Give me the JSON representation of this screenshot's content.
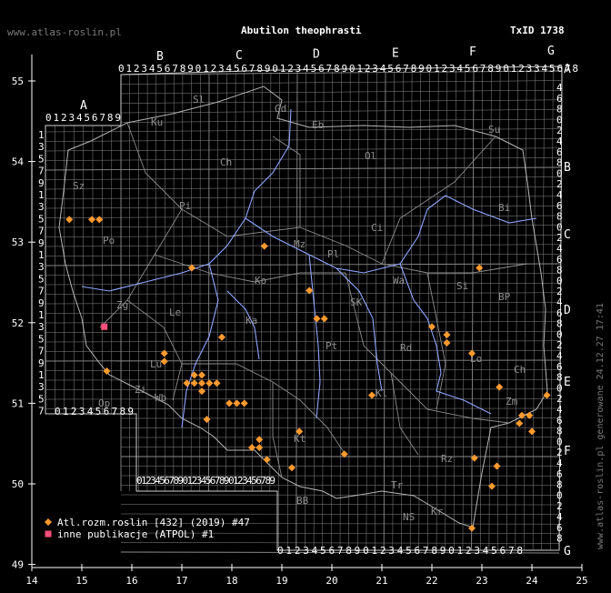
{
  "header": {
    "site": "www.atlas-roslin.pl",
    "title": "Abutilon theophrasti",
    "txid": "TxID 1738",
    "generated": "www.atlas-roslin.pl generowane 24.12.27 17:41"
  },
  "colors": {
    "background": "#000000",
    "grid": "#8a8a8a",
    "region_label": "#8f8f8f",
    "river": "#8fa6ff",
    "point_orange": "#ff9a2e",
    "point_pink": "#ff4f7b"
  },
  "axes": {
    "x_ticks": [
      "14",
      "15",
      "16",
      "17",
      "18",
      "19",
      "20",
      "21",
      "22",
      "23",
      "24",
      "25"
    ],
    "y_ticks": [
      "55",
      "54",
      "53",
      "52",
      "51",
      "50",
      "49"
    ]
  },
  "atpol": {
    "top_letters": [
      "B",
      "C",
      "D",
      "E",
      "F",
      "G"
    ],
    "left_letter": "A",
    "right_letters": [
      "A",
      "B",
      "C",
      "D",
      "E",
      "F",
      "G"
    ],
    "digits": "0123456789",
    "top_row": "012345678901234567890123456789012345678901234567890123345678",
    "left_top_row": "0123456789",
    "left_bottom_row": "0123456789",
    "bottom_row_left": "012345678901234567890123456789",
    "bottom_row_right": "01234567890123456789012345678",
    "right_col_labels": [
      "4",
      "6",
      "8",
      "0",
      "2",
      "4",
      "6",
      "8"
    ]
  },
  "region_labels": [
    "Sl",
    "Gd",
    "Eb",
    "Ku",
    "Ol",
    "Su",
    "Ch",
    "Sz",
    "Pi",
    "Bi",
    "Ci",
    "Pl",
    "Mz",
    "Po",
    "Ko",
    "Wa",
    "Si",
    "BP",
    "Zg",
    "Le",
    "Ka",
    "SK",
    "Lu",
    "Pt",
    "Rd",
    "Lo",
    "Zi",
    "Wb",
    "Ch",
    "Kl",
    "Op",
    "Zm",
    "Kt",
    "Tr",
    "Rz",
    "BB",
    "NS",
    "Kr"
  ],
  "legend": {
    "items": [
      {
        "label": "Atl.rozm.roslin [432] (2019) #47",
        "symbol": "diamond",
        "color": "#ff9a2e"
      },
      {
        "label": "inne publikacje (ATPOL) #1",
        "symbol": "square",
        "color": "#ff4f7b"
      }
    ]
  },
  "points_orange": [
    {
      "lon": 14.75,
      "lat": 53.28
    },
    {
      "lon": 15.2,
      "lat": 53.28
    },
    {
      "lon": 15.35,
      "lat": 53.28
    },
    {
      "lon": 18.65,
      "lat": 52.95
    },
    {
      "lon": 17.2,
      "lat": 52.68
    },
    {
      "lon": 22.95,
      "lat": 52.68
    },
    {
      "lon": 19.55,
      "lat": 52.4
    },
    {
      "lon": 19.7,
      "lat": 52.05
    },
    {
      "lon": 19.85,
      "lat": 52.05
    },
    {
      "lon": 22.0,
      "lat": 51.95
    },
    {
      "lon": 22.3,
      "lat": 51.85
    },
    {
      "lon": 22.3,
      "lat": 51.75
    },
    {
      "lon": 17.8,
      "lat": 51.82
    },
    {
      "lon": 22.8,
      "lat": 51.62
    },
    {
      "lon": 16.65,
      "lat": 51.62
    },
    {
      "lon": 16.65,
      "lat": 51.52
    },
    {
      "lon": 15.5,
      "lat": 51.4
    },
    {
      "lon": 17.25,
      "lat": 51.35
    },
    {
      "lon": 17.4,
      "lat": 51.35
    },
    {
      "lon": 17.1,
      "lat": 51.25
    },
    {
      "lon": 17.25,
      "lat": 51.25
    },
    {
      "lon": 17.4,
      "lat": 51.25
    },
    {
      "lon": 17.55,
      "lat": 51.25
    },
    {
      "lon": 17.7,
      "lat": 51.25
    },
    {
      "lon": 17.4,
      "lat": 51.15
    },
    {
      "lon": 23.35,
      "lat": 51.2
    },
    {
      "lon": 20.8,
      "lat": 51.1
    },
    {
      "lon": 24.3,
      "lat": 51.1
    },
    {
      "lon": 17.95,
      "lat": 51.0
    },
    {
      "lon": 18.1,
      "lat": 51.0
    },
    {
      "lon": 18.25,
      "lat": 51.0
    },
    {
      "lon": 23.8,
      "lat": 50.85
    },
    {
      "lon": 23.95,
      "lat": 50.85
    },
    {
      "lon": 23.75,
      "lat": 50.75
    },
    {
      "lon": 17.5,
      "lat": 50.8
    },
    {
      "lon": 24.0,
      "lat": 50.65
    },
    {
      "lon": 19.35,
      "lat": 50.65
    },
    {
      "lon": 18.55,
      "lat": 50.55
    },
    {
      "lon": 18.4,
      "lat": 50.45
    },
    {
      "lon": 18.55,
      "lat": 50.45
    },
    {
      "lon": 20.25,
      "lat": 50.37
    },
    {
      "lon": 18.7,
      "lat": 50.3
    },
    {
      "lon": 22.85,
      "lat": 50.32
    },
    {
      "lon": 19.2,
      "lat": 50.2
    },
    {
      "lon": 23.3,
      "lat": 50.22
    },
    {
      "lon": 23.2,
      "lat": 49.97
    },
    {
      "lon": 22.8,
      "lat": 49.45
    }
  ],
  "points_pink": [
    {
      "lon": 15.45,
      "lat": 51.95
    }
  ]
}
